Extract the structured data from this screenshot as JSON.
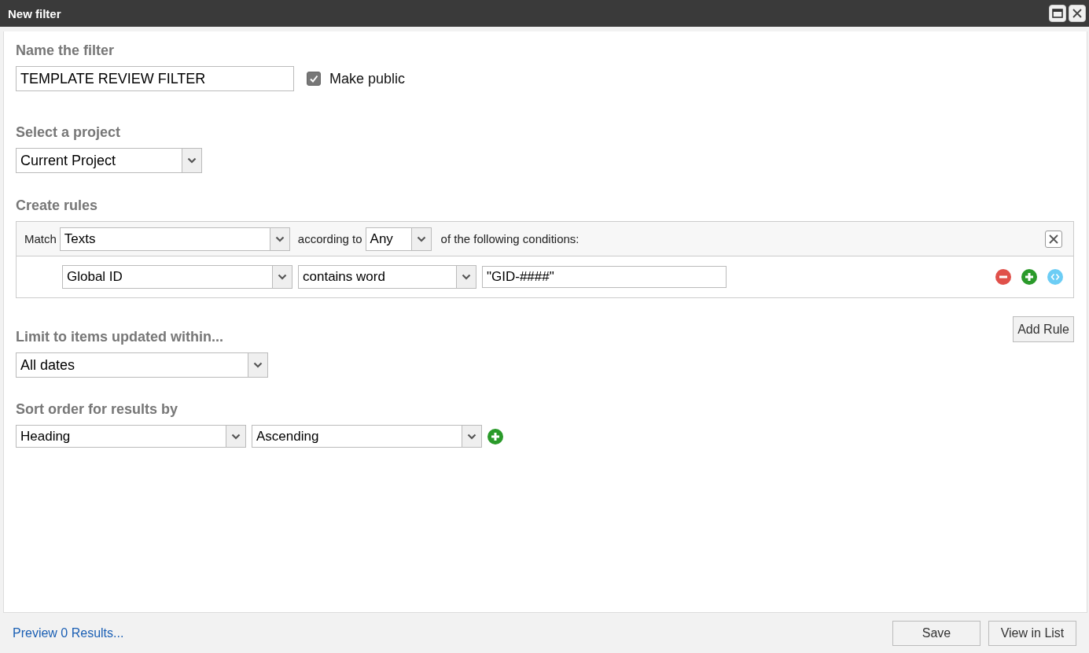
{
  "window": {
    "title": "New filter"
  },
  "name_section": {
    "heading": "Name the filter",
    "value": "TEMPLATE REVIEW FILTER",
    "make_public": {
      "label": "Make public",
      "checked": true
    }
  },
  "project_section": {
    "heading": "Select a project",
    "value": "Current Project"
  },
  "rules_section": {
    "heading": "Create rules",
    "match_label": "Match",
    "match_value": "Texts",
    "according_label": "according to",
    "according_value": "Any",
    "conditions_label": "of the following conditions:",
    "rules": [
      {
        "field": "Global ID",
        "operator": "contains word",
        "value": "\"GID-####\""
      }
    ],
    "add_rule": "Add Rule"
  },
  "limit_section": {
    "heading": "Limit to items updated within...",
    "value": "All dates"
  },
  "sort_section": {
    "heading": "Sort order for results by",
    "field": "Heading",
    "order": "Ascending"
  },
  "footer": {
    "preview_link": "Preview 0 Results...",
    "buttons": [
      "Save",
      "View in List"
    ]
  }
}
